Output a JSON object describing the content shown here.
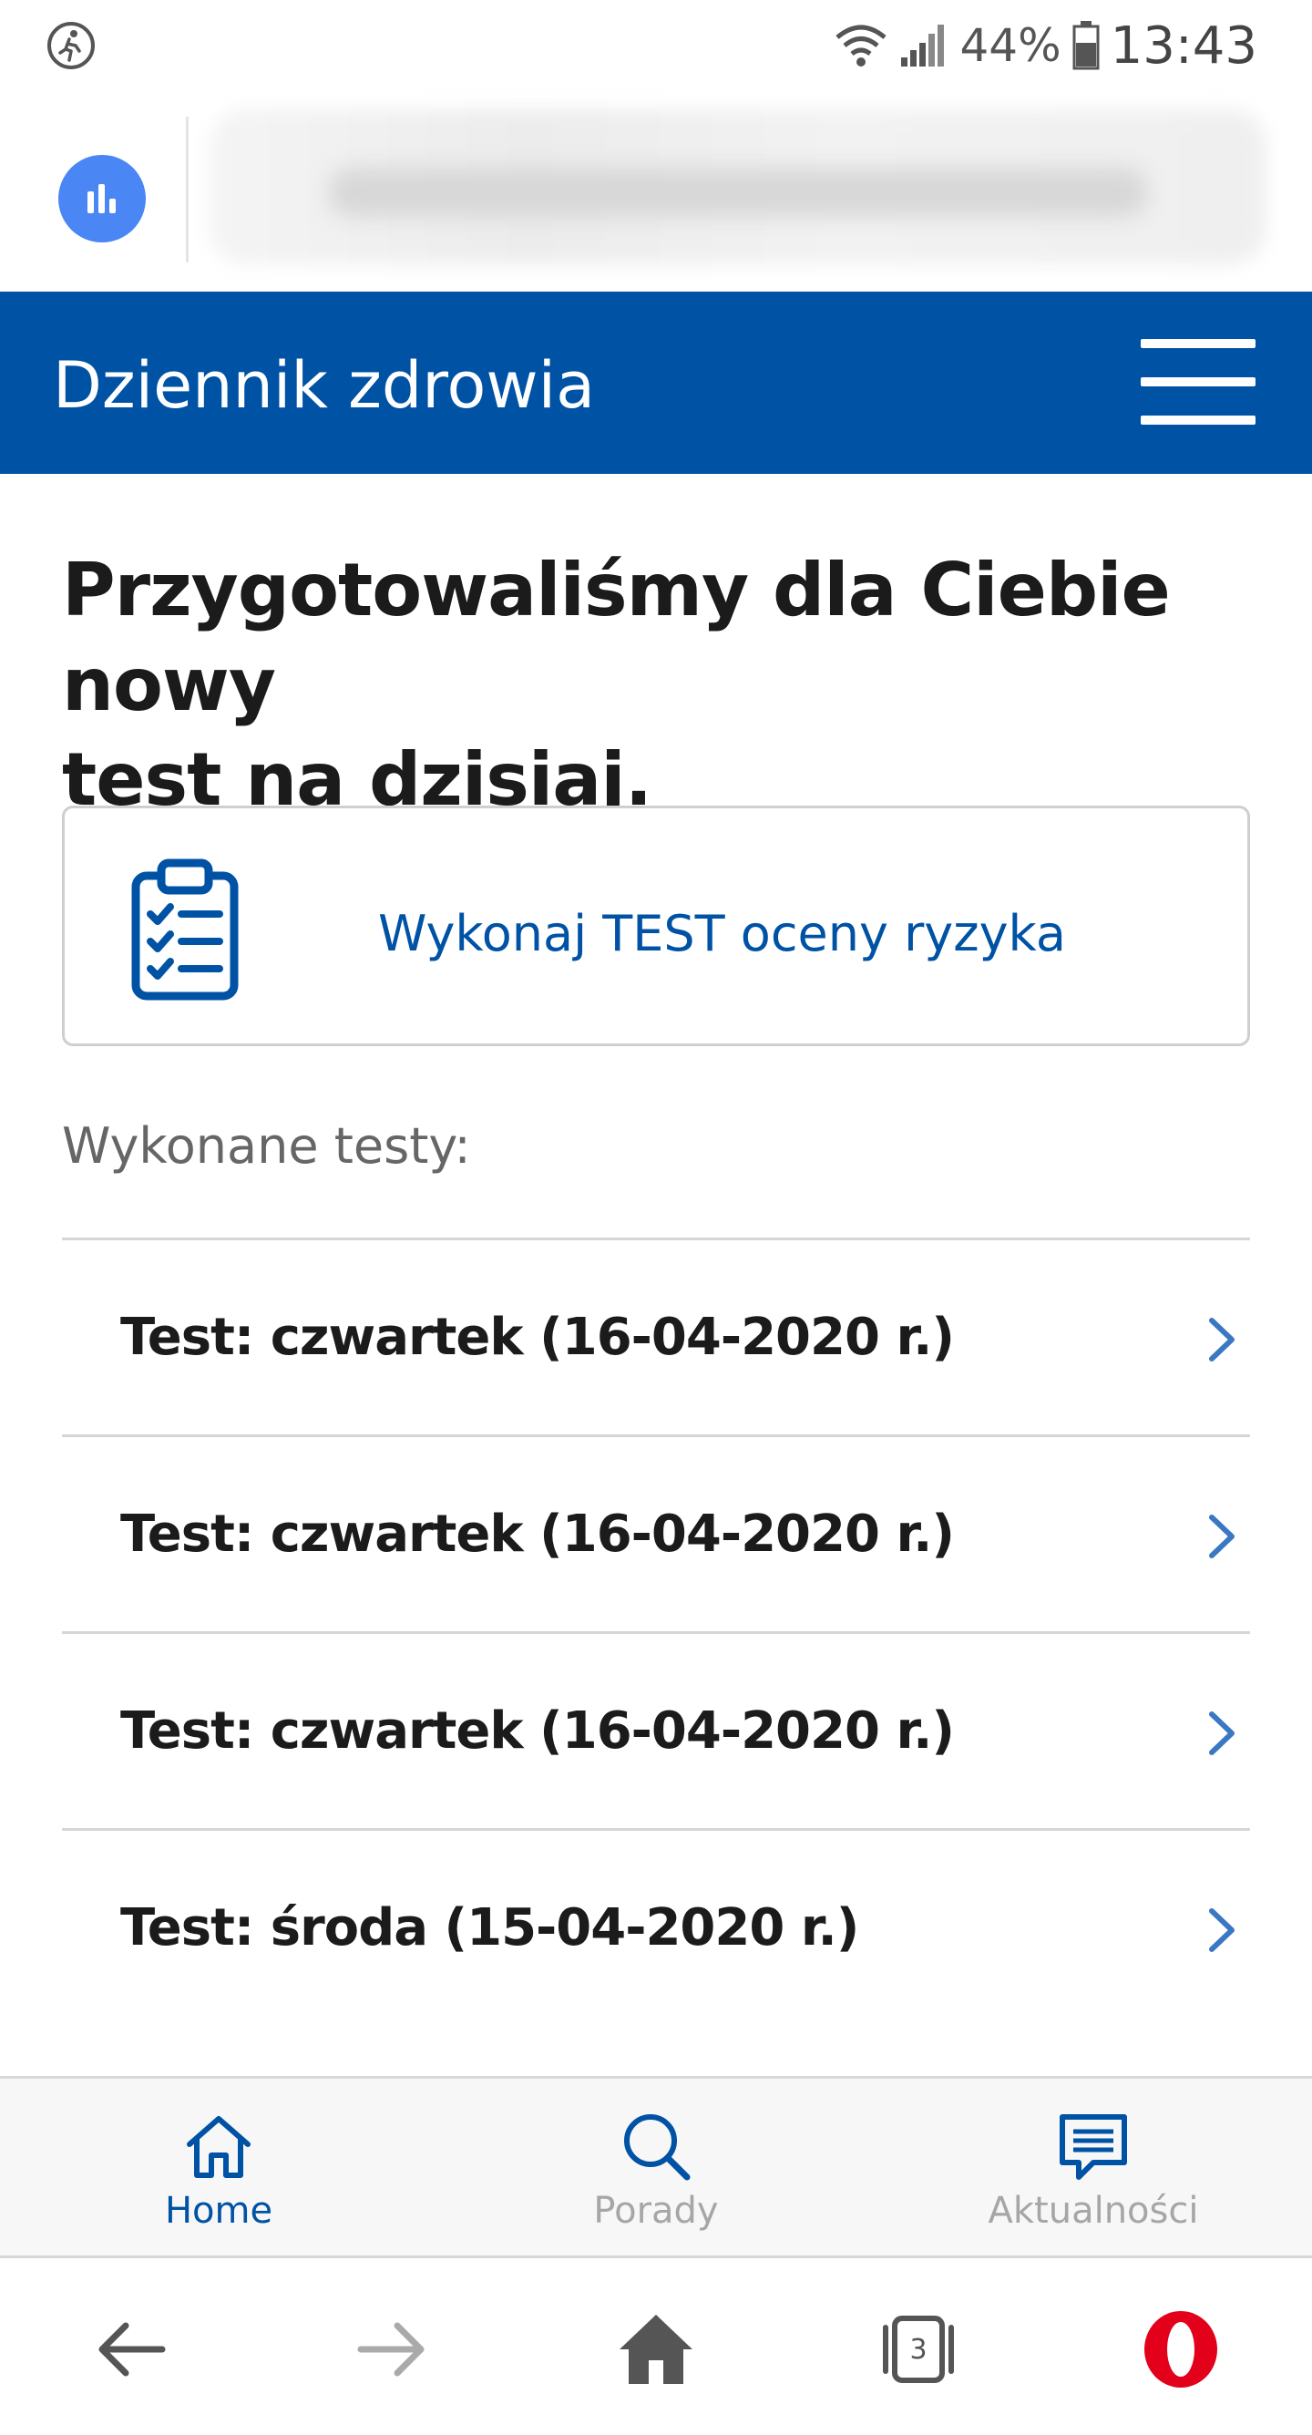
{
  "status_bar": {
    "battery_percent": "44%",
    "time": "13:43"
  },
  "site_header": {
    "title": "Dziennik zdrowia"
  },
  "main": {
    "headline_line1": "Przygotowaliśmy dla Ciebie nowy",
    "headline_line2": "test na dzisiaj.",
    "test_card_label": "Wykonaj TEST oceny ryzyka",
    "done_tests_label": "Wykonane testy:",
    "tests": [
      {
        "label": "Test: czwartek (16-04-2020 r.)"
      },
      {
        "label": "Test: czwartek (16-04-2020 r.)"
      },
      {
        "label": "Test: czwartek (16-04-2020 r.)"
      },
      {
        "label": "Test: środa (15-04-2020 r.)"
      }
    ]
  },
  "site_nav": {
    "items": [
      {
        "label": "Home",
        "icon": "home-icon",
        "active": true
      },
      {
        "label": "Porady",
        "icon": "search-icon",
        "active": false
      },
      {
        "label": "Aktualności",
        "icon": "news-icon",
        "active": false
      }
    ]
  },
  "browser_bar": {
    "tab_count": "3"
  },
  "colors": {
    "brand_blue": "#0052a5",
    "speed_dial_blue": "#4a86f4",
    "opera_red": "#e3001b",
    "inactive_gray": "#a6a6a6"
  }
}
